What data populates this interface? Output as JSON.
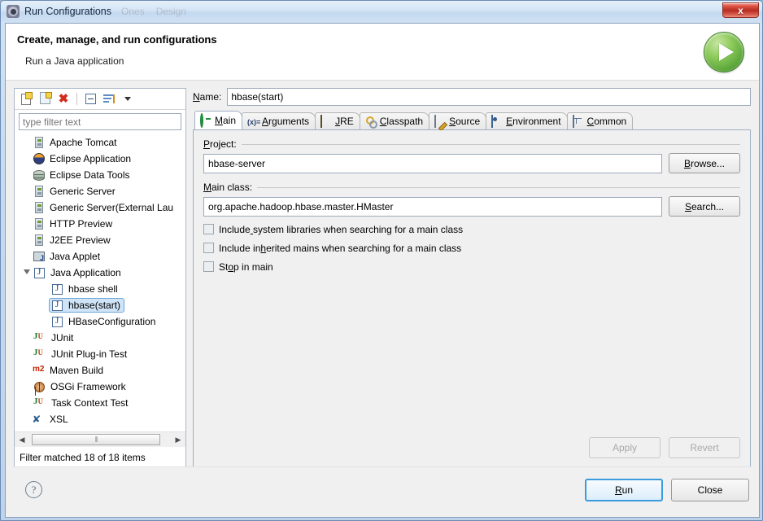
{
  "window": {
    "title": "Run Configurations",
    "title_icon": "gear-icon",
    "close_label": "x",
    "ghost_words": [
      "Ones",
      "Design"
    ]
  },
  "header": {
    "title": "Create, manage, and run configurations",
    "subtitle": "Run a Java application",
    "run_icon": "green-play-icon"
  },
  "tree_toolbar": {
    "new_config": "new-launch-configuration-icon",
    "duplicate": "duplicate-icon",
    "delete": "delete-icon",
    "collapse_all": "collapse-all-icon",
    "filter": "filter-icon",
    "caret": "chevron-down-icon",
    "delete_glyph": "✖"
  },
  "filter": {
    "placeholder": "type filter text",
    "value": ""
  },
  "tree": {
    "items": [
      {
        "label": "Apache Tomcat",
        "icon": "server-icon",
        "depth": 0,
        "selected": false,
        "expandable": false
      },
      {
        "label": "Eclipse Application",
        "icon": "eclipse-icon",
        "depth": 0,
        "selected": false,
        "expandable": false
      },
      {
        "label": "Eclipse Data Tools",
        "icon": "database-icon",
        "depth": 0,
        "selected": false,
        "expandable": false
      },
      {
        "label": "Generic Server",
        "icon": "server-icon",
        "depth": 0,
        "selected": false,
        "expandable": false
      },
      {
        "label": "Generic Server(External Lau",
        "icon": "server-icon",
        "depth": 0,
        "selected": false,
        "expandable": false
      },
      {
        "label": "HTTP Preview",
        "icon": "server-icon",
        "depth": 0,
        "selected": false,
        "expandable": false
      },
      {
        "label": "J2EE Preview",
        "icon": "server-icon",
        "depth": 0,
        "selected": false,
        "expandable": false
      },
      {
        "label": "Java Applet",
        "icon": "java-applet-icon",
        "depth": 0,
        "selected": false,
        "expandable": false
      },
      {
        "label": "Java Application",
        "icon": "java-icon",
        "depth": 0,
        "selected": false,
        "expandable": true,
        "expanded": true
      },
      {
        "label": "hbase shell",
        "icon": "java-icon",
        "depth": 1,
        "selected": false,
        "expandable": false
      },
      {
        "label": "hbase(start)",
        "icon": "java-icon",
        "depth": 1,
        "selected": true,
        "expandable": false
      },
      {
        "label": "HBaseConfiguration",
        "icon": "java-icon",
        "depth": 1,
        "selected": false,
        "expandable": false
      },
      {
        "label": "JUnit",
        "icon": "junit-icon",
        "depth": 0,
        "selected": false,
        "expandable": false
      },
      {
        "label": "JUnit Plug-in Test",
        "icon": "junit-plugin-icon",
        "depth": 0,
        "selected": false,
        "expandable": false
      },
      {
        "label": "Maven Build",
        "icon": "maven-icon",
        "depth": 0,
        "selected": false,
        "expandable": false
      },
      {
        "label": "OSGi Framework",
        "icon": "osgi-icon",
        "depth": 0,
        "selected": false,
        "expandable": false
      },
      {
        "label": "Task Context Test",
        "icon": "junit-task-icon",
        "depth": 0,
        "selected": false,
        "expandable": false
      },
      {
        "label": "XSL",
        "icon": "xsl-icon",
        "depth": 0,
        "selected": false,
        "expandable": false
      }
    ],
    "status": "Filter matched 18 of 18 items",
    "scroll_left_arrow": "◀",
    "scroll_right_arrow": "▶"
  },
  "name_field": {
    "label": "Name:",
    "value": "hbase(start)"
  },
  "tabs": [
    {
      "label": "Main",
      "icon": "main-icon",
      "active": true
    },
    {
      "label": "Arguments",
      "icon": "arguments-icon",
      "active": false,
      "icon_text": "(x)="
    },
    {
      "label": "JRE",
      "icon": "jre-icon",
      "active": false
    },
    {
      "label": "Classpath",
      "icon": "classpath-icon",
      "active": false
    },
    {
      "label": "Source",
      "icon": "source-icon",
      "active": false
    },
    {
      "label": "Environment",
      "icon": "environment-icon",
      "active": false
    },
    {
      "label": "Common",
      "icon": "common-icon",
      "active": false
    }
  ],
  "main_tab": {
    "project_group_label": "Project:",
    "project_value": "hbase-server",
    "browse_label": "Browse...",
    "main_class_group_label": "Main class:",
    "main_class_value": "org.apache.hadoop.hbase.master.HMaster",
    "search_label": "Search...",
    "checkboxes": [
      {
        "label": "Include system libraries when searching for a main class",
        "checked": false
      },
      {
        "label": "Include inherited mains when searching for a main class",
        "checked": false
      },
      {
        "label": "Stop in main",
        "checked": false
      }
    ],
    "apply_label": "Apply",
    "apply_enabled": false,
    "revert_label": "Revert",
    "revert_enabled": false
  },
  "footer": {
    "help_icon": "help-icon",
    "help_glyph": "?",
    "run_label": "Run",
    "close_label": "Close"
  },
  "colors": {
    "accent_blue": "#3c9bdc",
    "selection_fill": "#cfe4f7",
    "selection_border": "#6ea7d8",
    "run_green": "#5ba63a",
    "close_red": "#b72b20",
    "dialog_bg": "#f0f0f0"
  }
}
